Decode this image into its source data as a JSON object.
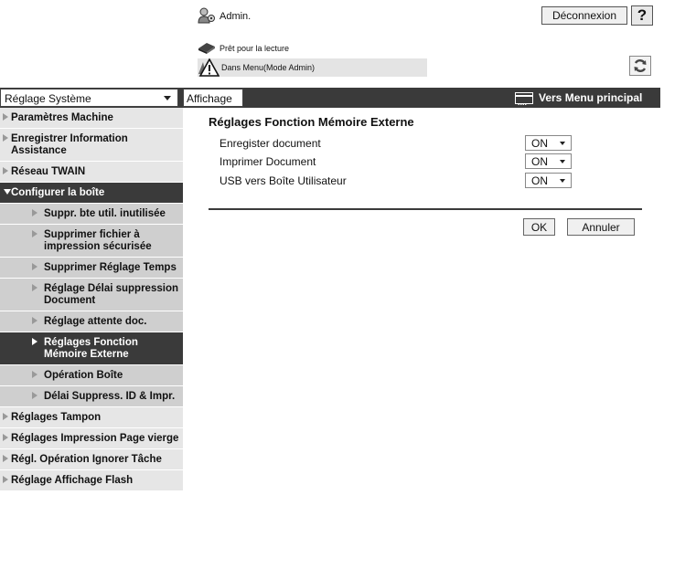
{
  "header": {
    "admin_label": "Admin.",
    "logout_label": "Déconnexion",
    "help_label": "?",
    "status_label": "Prêt pour la lecture",
    "mode_label": "Dans Menu(Mode Admin)"
  },
  "navbar": {
    "system_select_value": "Réglage Système",
    "tab_label": "Affichage",
    "main_menu_label": "Vers Menu principal"
  },
  "sidebar": {
    "items": [
      {
        "label": "Paramètres Machine",
        "level": "top"
      },
      {
        "label": "Enregistrer Information Assistance",
        "level": "top"
      },
      {
        "label": "Réseau TWAIN",
        "level": "top"
      },
      {
        "label": "Configurer la boîte",
        "level": "top",
        "state": "open"
      },
      {
        "label": "Suppr. bte util. inutilisée",
        "level": "sub"
      },
      {
        "label": "Supprimer fichier à impression sécurisée",
        "level": "sub"
      },
      {
        "label": "Supprimer Réglage Temps",
        "level": "sub"
      },
      {
        "label": "Réglage Délai suppression Document",
        "level": "sub"
      },
      {
        "label": "Réglage attente doc.",
        "level": "sub"
      },
      {
        "label": "Réglages Fonction Mémoire Externe",
        "level": "sub",
        "state": "active"
      },
      {
        "label": "Opération Boîte",
        "level": "sub"
      },
      {
        "label": "Délai Suppress. ID & Impr.",
        "level": "sub"
      },
      {
        "label": "Réglages Tampon",
        "level": "top"
      },
      {
        "label": "Réglages Impression Page vierge",
        "level": "top"
      },
      {
        "label": "Régl. Opération Ignorer Tâche",
        "level": "top"
      },
      {
        "label": "Réglage Affichage Flash",
        "level": "top"
      }
    ]
  },
  "main": {
    "title": "Réglages Fonction Mémoire Externe",
    "settings": [
      {
        "label": "Enregister document",
        "value": "ON"
      },
      {
        "label": "Imprimer Document",
        "value": "ON"
      },
      {
        "label": "USB vers Boîte Utilisateur",
        "value": "ON"
      }
    ],
    "ok_label": "OK",
    "cancel_label": "Annuler"
  },
  "colors": {
    "dark_bar": "#3a3a3a",
    "sidebar_top": "#e6e6e6",
    "sidebar_sub": "#cfcfcf"
  }
}
